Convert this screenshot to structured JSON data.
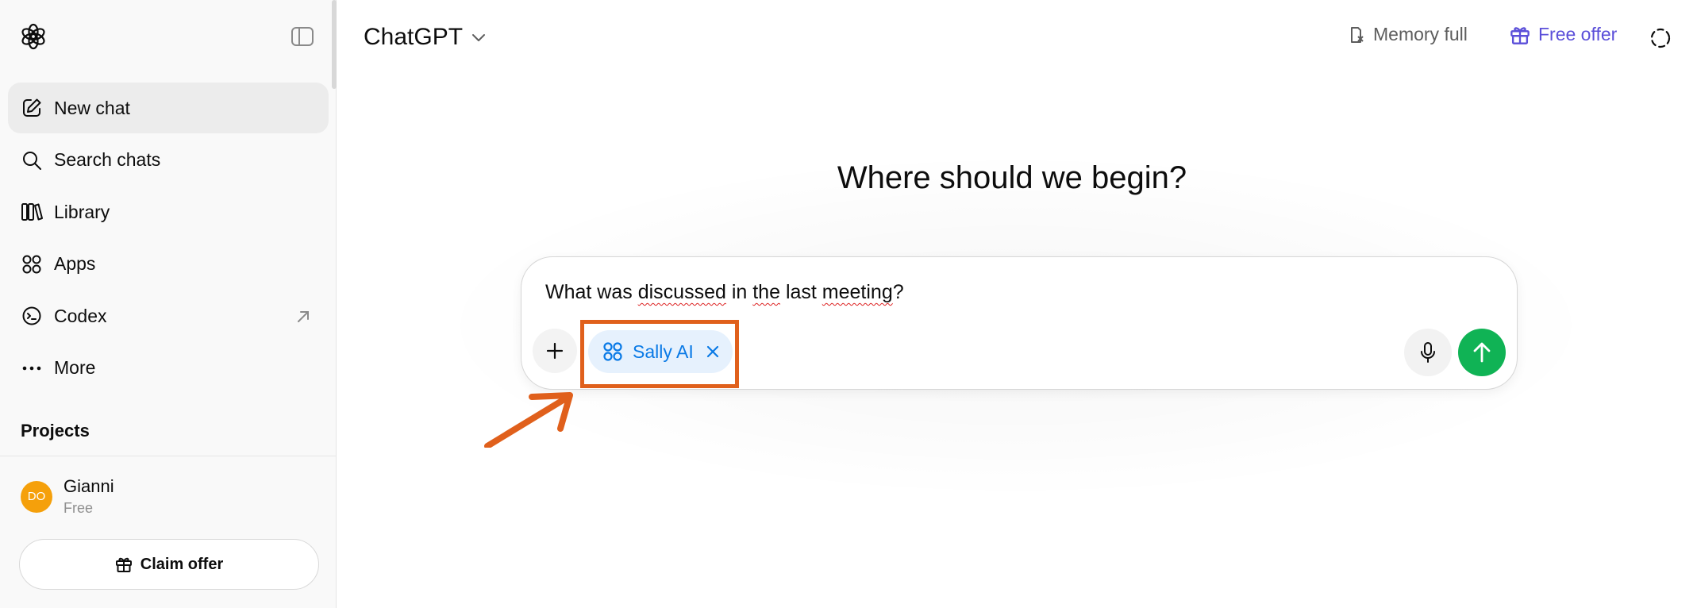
{
  "sidebar": {
    "items": [
      {
        "label": "New chat",
        "icon": "compose-icon",
        "active": true
      },
      {
        "label": "Search chats",
        "icon": "search-icon"
      },
      {
        "label": "Library",
        "icon": "library-icon"
      },
      {
        "label": "Apps",
        "icon": "apps-icon"
      },
      {
        "label": "Codex",
        "icon": "codex-icon",
        "external": true
      },
      {
        "label": "More",
        "icon": "more-icon"
      }
    ],
    "projects_title": "Projects",
    "user": {
      "initials": "DO",
      "name": "Gianni",
      "plan": "Free"
    },
    "claim_offer_label": "Claim offer"
  },
  "header": {
    "title": "ChatGPT",
    "memory_label": "Memory full",
    "free_offer_label": "Free offer"
  },
  "main": {
    "heading": "Where should we begin?",
    "composer": {
      "text_parts": [
        "What was ",
        "discussed",
        " in ",
        "the",
        " last ",
        "meeting",
        "?"
      ],
      "chip_label": "Sally AI"
    }
  },
  "colors": {
    "accent_purple": "#5b4fd9",
    "chip_blue": "#0a7ae6",
    "send_green": "#10b355",
    "annotation_orange": "#e0601c",
    "avatar_orange": "#f5a00b"
  }
}
